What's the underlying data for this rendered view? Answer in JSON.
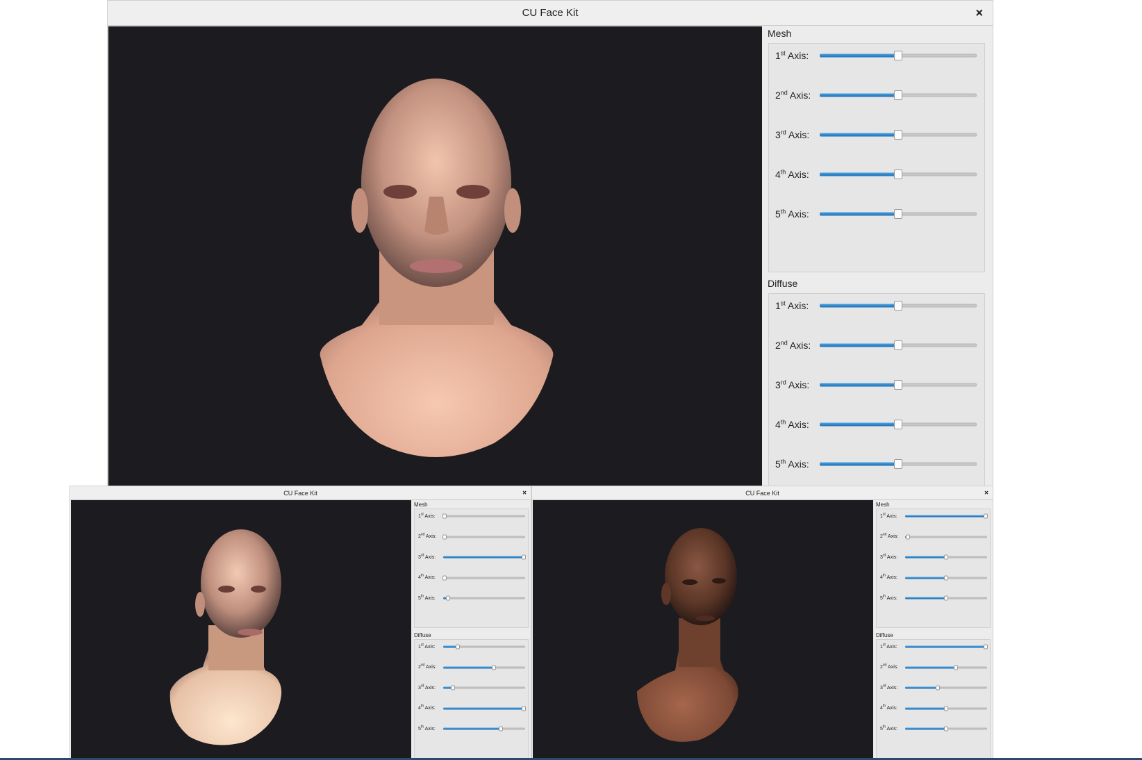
{
  "windows": [
    {
      "id": "main",
      "title": "CU Face Kit",
      "close_icon": "×",
      "groups": [
        {
          "title": "Mesh",
          "axes": [
            {
              "num": "1",
              "sup": "st",
              "suffix": " Axis:",
              "value": 0.5
            },
            {
              "num": "2",
              "sup": "nd",
              "suffix": " Axis:",
              "value": 0.5
            },
            {
              "num": "3",
              "sup": "rd",
              "suffix": " Axis:",
              "value": 0.5
            },
            {
              "num": "4",
              "sup": "th",
              "suffix": " Axis:",
              "value": 0.5
            },
            {
              "num": "5",
              "sup": "th",
              "suffix": " Axis:",
              "value": 0.5
            }
          ]
        },
        {
          "title": "Diffuse",
          "axes": [
            {
              "num": "1",
              "sup": "st",
              "suffix": " Axis:",
              "value": 0.5
            },
            {
              "num": "2",
              "sup": "nd",
              "suffix": " Axis:",
              "value": 0.5
            },
            {
              "num": "3",
              "sup": "rd",
              "suffix": " Axis:",
              "value": 0.5
            },
            {
              "num": "4",
              "sup": "th",
              "suffix": " Axis:",
              "value": 0.5
            },
            {
              "num": "5",
              "sup": "th",
              "suffix": " Axis:",
              "value": 0.5
            }
          ]
        }
      ]
    },
    {
      "id": "bottom-left",
      "title": "CU Face Kit",
      "close_icon": "×",
      "groups": [
        {
          "title": "Mesh",
          "axes": [
            {
              "num": "1",
              "sup": "st",
              "suffix": " Axis:",
              "value": 0.02
            },
            {
              "num": "2",
              "sup": "nd",
              "suffix": " Axis:",
              "value": 0.02
            },
            {
              "num": "3",
              "sup": "rd",
              "suffix": " Axis:",
              "value": 0.98
            },
            {
              "num": "4",
              "sup": "th",
              "suffix": " Axis:",
              "value": 0.02
            },
            {
              "num": "5",
              "sup": "th",
              "suffix": " Axis:",
              "value": 0.06
            }
          ]
        },
        {
          "title": "Diffuse",
          "axes": [
            {
              "num": "1",
              "sup": "st",
              "suffix": " Axis:",
              "value": 0.18
            },
            {
              "num": "2",
              "sup": "nd",
              "suffix": " Axis:",
              "value": 0.62
            },
            {
              "num": "3",
              "sup": "rd",
              "suffix": " Axis:",
              "value": 0.12
            },
            {
              "num": "4",
              "sup": "th",
              "suffix": " Axis:",
              "value": 0.98
            },
            {
              "num": "5",
              "sup": "th",
              "suffix": " Axis:",
              "value": 0.7
            }
          ]
        }
      ]
    },
    {
      "id": "bottom-right",
      "title": "CU Face Kit",
      "close_icon": "×",
      "groups": [
        {
          "title": "Mesh",
          "axes": [
            {
              "num": "1",
              "sup": "st",
              "suffix": " Axis:",
              "value": 0.98
            },
            {
              "num": "2",
              "sup": "nd",
              "suffix": " Axis:",
              "value": 0.03
            },
            {
              "num": "3",
              "sup": "rd",
              "suffix": " Axis:",
              "value": 0.5
            },
            {
              "num": "4",
              "sup": "th",
              "suffix": " Axis:",
              "value": 0.5
            },
            {
              "num": "5",
              "sup": "th",
              "suffix": " Axis:",
              "value": 0.5
            }
          ]
        },
        {
          "title": "Diffuse",
          "axes": [
            {
              "num": "1",
              "sup": "st",
              "suffix": " Axis:",
              "value": 0.98
            },
            {
              "num": "2",
              "sup": "nd",
              "suffix": " Axis:",
              "value": 0.62
            },
            {
              "num": "3",
              "sup": "rd",
              "suffix": " Axis:",
              "value": 0.4
            },
            {
              "num": "4",
              "sup": "th",
              "suffix": " Axis:",
              "value": 0.5
            },
            {
              "num": "5",
              "sup": "th",
              "suffix": " Axis:",
              "value": 0.5
            }
          ]
        }
      ]
    }
  ],
  "colors": {
    "viewport_bg": "#1c1b20",
    "slider_fill": "#1f6fb5",
    "skin_light": "#e7b9a0",
    "skin_dark": "#7a4a34"
  },
  "icons": {
    "close": "close-icon",
    "head": "head-model-icon"
  }
}
